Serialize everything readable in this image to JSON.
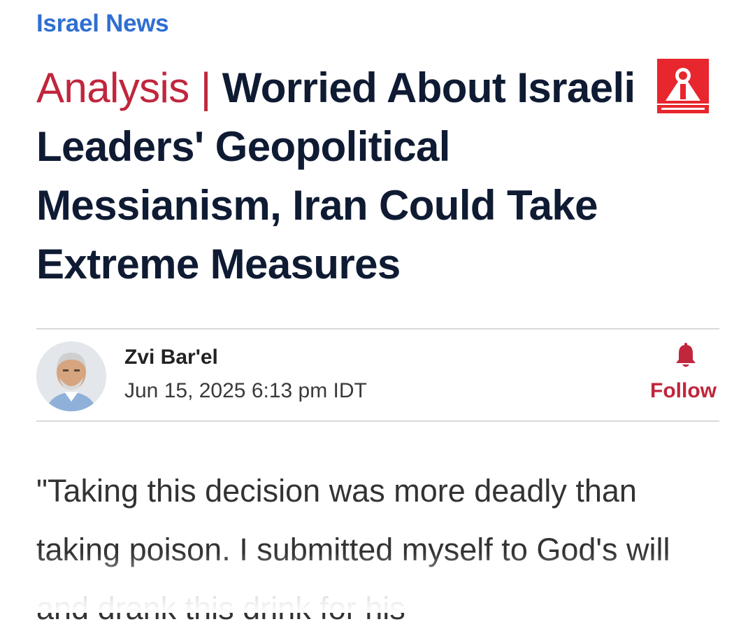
{
  "section": {
    "label": "Israel News"
  },
  "headline": {
    "kicker": "Analysis",
    "separator": "|",
    "title": "Worried About Israeli Leaders' Geopolitical Messianism, Iran Could Take Extreme Measures"
  },
  "author": {
    "name": "Zvi Bar'el",
    "date": "Jun 15, 2025 6:13 pm IDT"
  },
  "follow": {
    "label": "Follow",
    "icon": "bell-icon"
  },
  "article": {
    "lead": "\"Taking this decision was more deadly than taking poison. I submitted myself to God's will and drank this drink for his"
  },
  "watermark": {
    "icon": "channel-logo"
  },
  "colors": {
    "section_link": "#2f6fd1",
    "kicker": "#c0263c",
    "headline": "#0f1b33",
    "follow": "#c0263c",
    "divider": "#d9d9d9"
  }
}
